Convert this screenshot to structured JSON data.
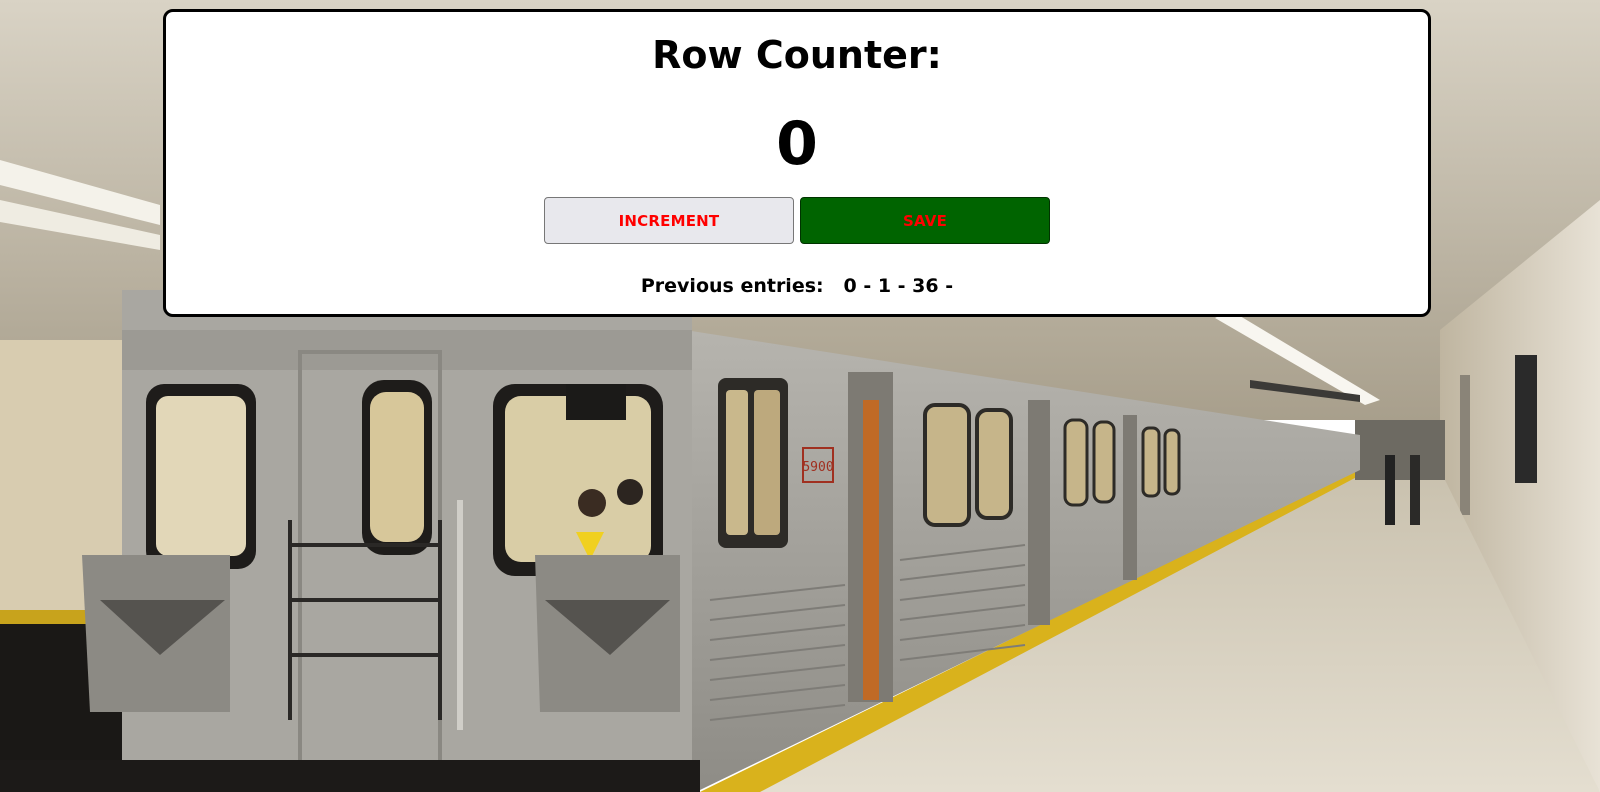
{
  "counter": {
    "title": "Row Counter:",
    "value": "0"
  },
  "actions": {
    "increment_label": "INCREMENT",
    "save_label": "SAVE"
  },
  "history": {
    "label": "Previous entries:",
    "entries_text": "0 - 1 - 36 -",
    "entries": [
      "0",
      "1",
      "36"
    ]
  },
  "colors": {
    "card_background": "#ffffff",
    "button_text": "#ff0000",
    "increment_background": "#e8e8ed",
    "save_background": "#006400"
  },
  "background": {
    "image_subject": "subway-train-at-platform",
    "car_number": "5900"
  }
}
